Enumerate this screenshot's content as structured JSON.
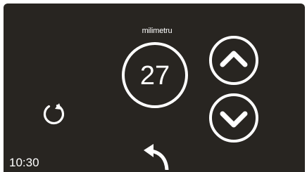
{
  "display": {
    "unit_label": "milimetru",
    "value": "27"
  },
  "controls": {
    "up_icon": "chevron-up-circle",
    "down_icon": "chevron-down-circle",
    "reset_icon": "refresh",
    "back_icon": "back-arrow"
  },
  "status": {
    "time": "10:30"
  },
  "colors": {
    "background": "#282521",
    "foreground": "#ffffff"
  }
}
